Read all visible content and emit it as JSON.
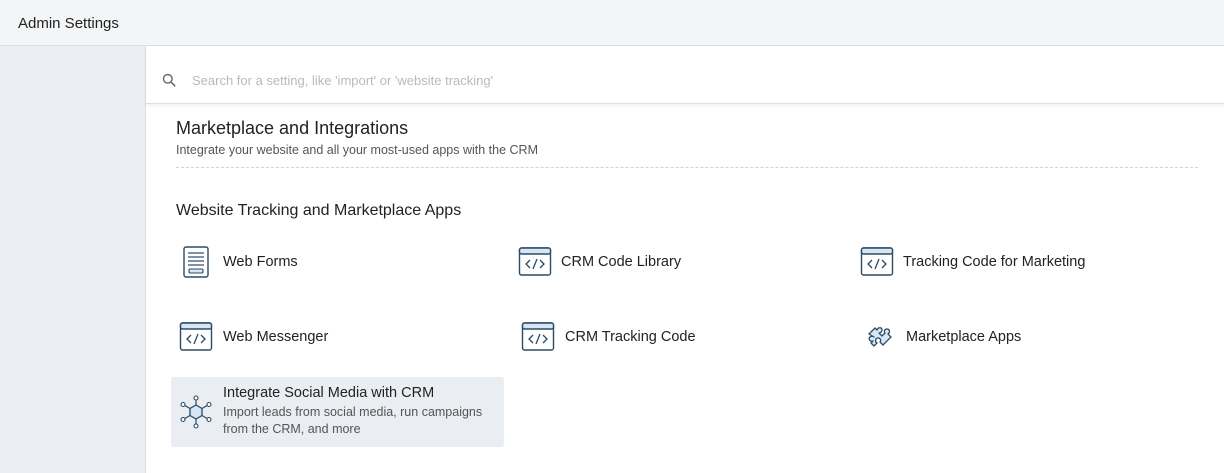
{
  "header": {
    "title": "Admin Settings"
  },
  "search": {
    "placeholder": "Search for a setting, like 'import' or 'website tracking'",
    "value": ""
  },
  "section": {
    "title": "Marketplace and Integrations",
    "description": "Integrate your website and all your most-used apps with the CRM"
  },
  "group": {
    "title": "Website Tracking and Marketplace Apps",
    "items": [
      {
        "label": "Web Forms",
        "icon": "web-form-icon"
      },
      {
        "label": "CRM Code Library",
        "icon": "code-window-icon"
      },
      {
        "label": "Tracking Code for Marketing",
        "icon": "code-window-icon"
      },
      {
        "label": "Web Messenger",
        "icon": "code-window-icon"
      },
      {
        "label": "CRM Tracking Code",
        "icon": "code-window-icon"
      },
      {
        "label": "Marketplace Apps",
        "icon": "puzzle-piece-icon"
      },
      {
        "label": "Integrate Social Media with CRM",
        "description": "Import leads from social media, run campaigns from the CRM, and more",
        "icon": "social-network-icon"
      }
    ]
  },
  "colors": {
    "icon_stroke": "#2b4a66",
    "icon_fill": "#d6e6f5",
    "highlight": "#eaedf1"
  }
}
